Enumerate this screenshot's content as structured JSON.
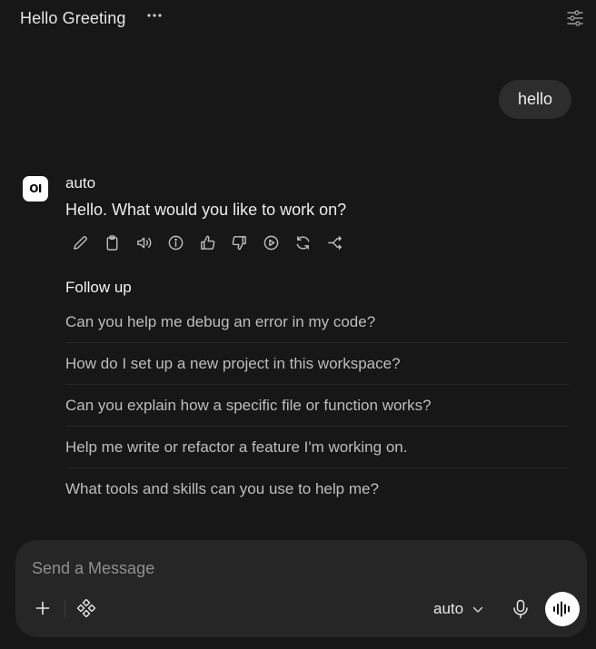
{
  "header": {
    "title": "Hello Greeting",
    "more_icon": "more-horizontal-icon",
    "settings_icon": "sliders-icon"
  },
  "user_message": {
    "text": "hello"
  },
  "assistant": {
    "avatar_text": "OI",
    "model": "auto",
    "reply": "Hello. What would you like to work on?",
    "actions": [
      {
        "icon": "pencil-icon",
        "name": "edit"
      },
      {
        "icon": "clipboard-icon",
        "name": "copy"
      },
      {
        "icon": "speaker-icon",
        "name": "read-aloud"
      },
      {
        "icon": "info-icon",
        "name": "info"
      },
      {
        "icon": "thumbs-up-icon",
        "name": "good-response"
      },
      {
        "icon": "thumbs-down-icon",
        "name": "bad-response"
      },
      {
        "icon": "play-circle-icon",
        "name": "continue"
      },
      {
        "icon": "refresh-icon",
        "name": "regenerate"
      },
      {
        "icon": "branch-icon",
        "name": "branch"
      }
    ]
  },
  "follow_up": {
    "title": "Follow up",
    "items": [
      "Can you help me debug an error in my code?",
      "How do I set up a new project in this workspace?",
      "Can you explain how a specific file or function works?",
      "Help me write or refactor a feature I'm working on.",
      "What tools and skills can you use to help me?"
    ]
  },
  "composer": {
    "placeholder": "Send a Message",
    "value": "",
    "model": "auto",
    "icons": [
      "plus-icon",
      "integrations-icon",
      "chevron-down-icon",
      "microphone-icon",
      "voice-mode-icon"
    ]
  },
  "colors": {
    "background": "#171717",
    "bubble": "#2d2d2d",
    "composer": "#262626",
    "accent": "#ffffff"
  }
}
